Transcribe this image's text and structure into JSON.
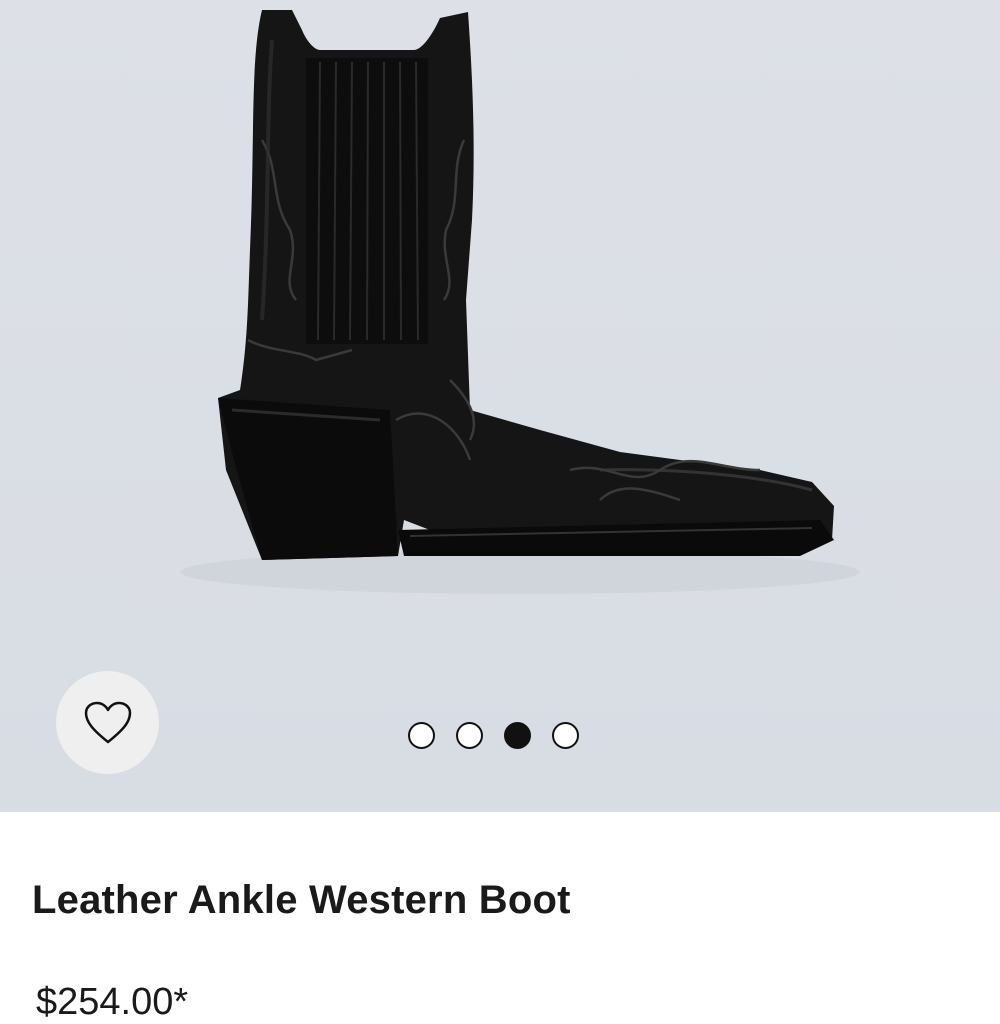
{
  "product": {
    "name": "Leather Ankle Western Boot",
    "price": "$254.00*",
    "image_alt": "black leather ankle western boot"
  },
  "gallery": {
    "slide_count": 4,
    "active_slide": 3,
    "background": "#dde1e7"
  },
  "wishlist": {
    "icon": "heart-outline-icon"
  },
  "colors": {
    "text": "#1a1a1a",
    "dot_active": "#111111",
    "wishlist_bg": "#efefef"
  }
}
